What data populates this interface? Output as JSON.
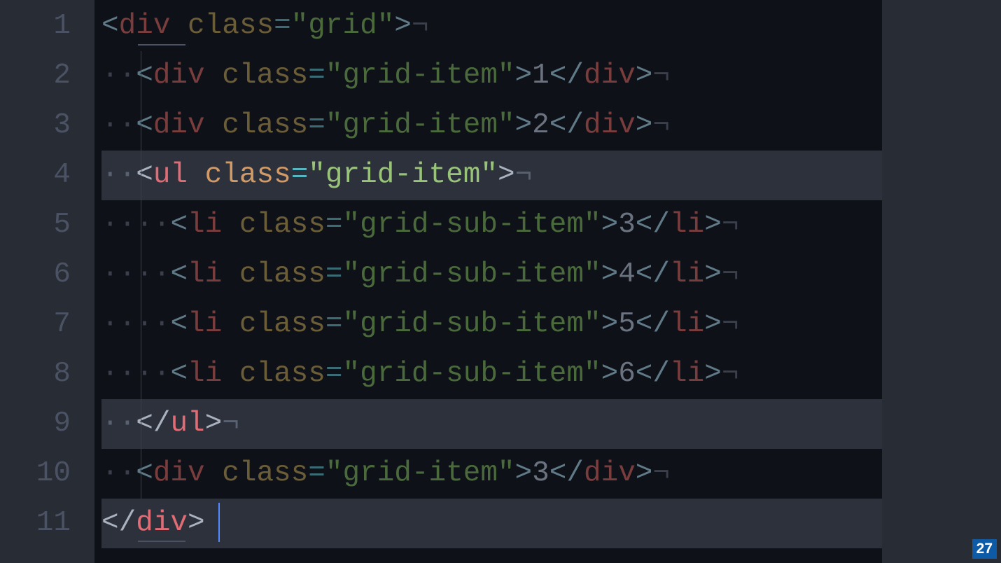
{
  "slide_number": "27",
  "line_numbers": [
    "1",
    "2",
    "3",
    "4",
    "5",
    "6",
    "7",
    "8",
    "9",
    "10",
    "11"
  ],
  "active_lines": [
    4,
    9,
    11
  ],
  "code": {
    "tag_div": "div",
    "tag_ul": "ul",
    "tag_li": "li",
    "attr_class": "class",
    "eq": "=",
    "val_grid": "\"grid\"",
    "val_grid_item": "\"grid-item\"",
    "val_grid_sub_item": "\"grid-sub-item\"",
    "txt_1": "1",
    "txt_2": "2",
    "txt_3": "3",
    "txt_4": "4",
    "txt_5": "5",
    "txt_6": "6",
    "dot": "·",
    "nl": "¬",
    "lt": "<",
    "gt": ">",
    "lts": "</"
  }
}
